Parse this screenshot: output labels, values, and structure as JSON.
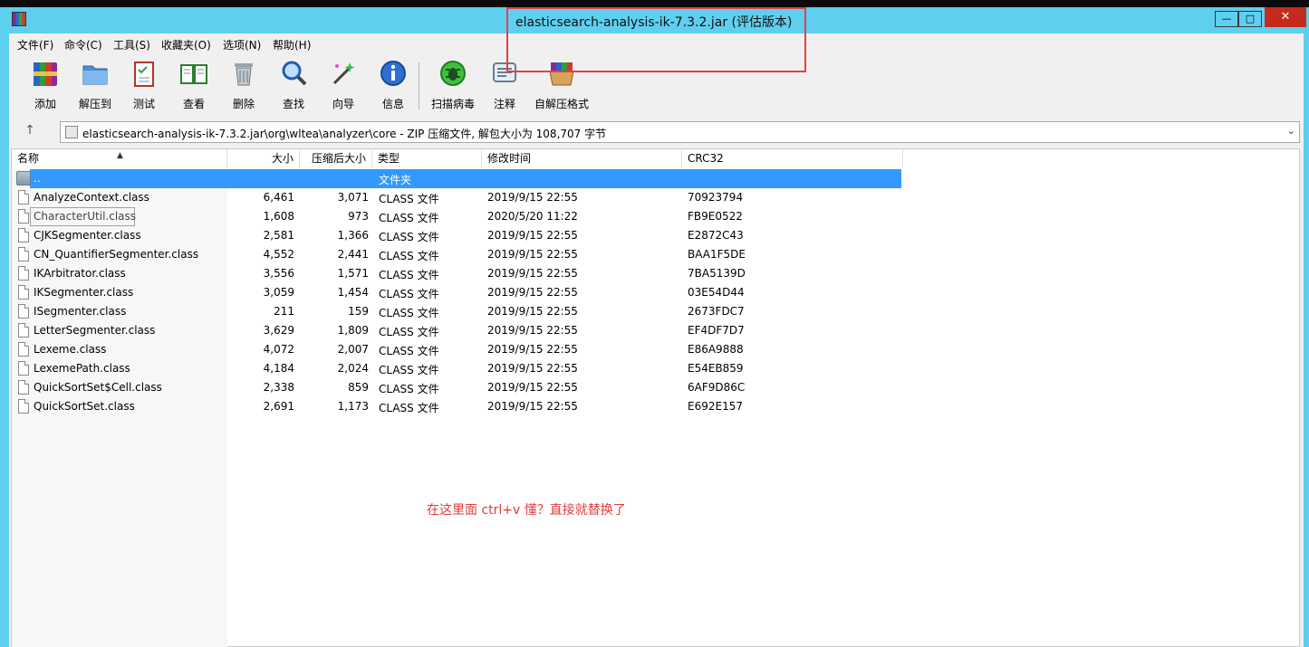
{
  "window": {
    "title": "elasticsearch-analysis-ik-7.3.2.jar (评估版本)",
    "controls": {
      "minimize": "—",
      "maximize": "□",
      "close": "✕"
    }
  },
  "menu": [
    "文件(F)",
    "命令(C)",
    "工具(S)",
    "收藏夹(O)",
    "选项(N)",
    "帮助(H)"
  ],
  "toolbar": [
    {
      "label": "添加",
      "icon": "add-archive-icon"
    },
    {
      "label": "解压到",
      "icon": "extract-to-icon"
    },
    {
      "label": "测试",
      "icon": "test-icon"
    },
    {
      "label": "查看",
      "icon": "view-icon"
    },
    {
      "label": "删除",
      "icon": "delete-icon"
    },
    {
      "label": "查找",
      "icon": "find-icon"
    },
    {
      "label": "向导",
      "icon": "wizard-icon"
    },
    {
      "label": "信息",
      "icon": "info-icon"
    },
    {
      "label": "扫描病毒",
      "icon": "virus-scan-icon"
    },
    {
      "label": "注释",
      "icon": "comment-icon"
    },
    {
      "label": "自解压格式",
      "icon": "sfx-icon"
    }
  ],
  "address": {
    "up": "↑",
    "path": "elasticsearch-analysis-ik-7.3.2.jar\\org\\wltea\\analyzer\\core - ZIP 压缩文件, 解包大小为 108,707 字节",
    "dropdown": "⌄"
  },
  "columns": {
    "name": "名称",
    "size": "大小",
    "packed": "压缩后大小",
    "type": "类型",
    "modified": "修改时间",
    "crc": "CRC32"
  },
  "sort_arrow": "▲",
  "parent_row": {
    "name": "..",
    "type": "文件夹"
  },
  "files": [
    {
      "name": "AnalyzeContext.class",
      "size": "6,461",
      "packed": "3,071",
      "type": "CLASS 文件",
      "modified": "2019/9/15 22:55",
      "crc": "70923794"
    },
    {
      "name": "CharacterUtil.class",
      "size": "1,608",
      "packed": "973",
      "type": "CLASS 文件",
      "modified": "2020/5/20 11:22",
      "crc": "FB9E0522"
    },
    {
      "name": "CJKSegmenter.class",
      "size": "2,581",
      "packed": "1,366",
      "type": "CLASS 文件",
      "modified": "2019/9/15 22:55",
      "crc": "E2872C43"
    },
    {
      "name": "CN_QuantifierSegmenter.class",
      "size": "4,552",
      "packed": "2,441",
      "type": "CLASS 文件",
      "modified": "2019/9/15 22:55",
      "crc": "BAA1F5DE"
    },
    {
      "name": "IKArbitrator.class",
      "size": "3,556",
      "packed": "1,571",
      "type": "CLASS 文件",
      "modified": "2019/9/15 22:55",
      "crc": "7BA5139D"
    },
    {
      "name": "IKSegmenter.class",
      "size": "3,059",
      "packed": "1,454",
      "type": "CLASS 文件",
      "modified": "2019/9/15 22:55",
      "crc": "03E54D44"
    },
    {
      "name": "ISegmenter.class",
      "size": "211",
      "packed": "159",
      "type": "CLASS 文件",
      "modified": "2019/9/15 22:55",
      "crc": "2673FDC7"
    },
    {
      "name": "LetterSegmenter.class",
      "size": "3,629",
      "packed": "1,809",
      "type": "CLASS 文件",
      "modified": "2019/9/15 22:55",
      "crc": "EF4DF7D7"
    },
    {
      "name": "Lexeme.class",
      "size": "4,072",
      "packed": "2,007",
      "type": "CLASS 文件",
      "modified": "2019/9/15 22:55",
      "crc": "E86A9888"
    },
    {
      "name": "LexemePath.class",
      "size": "4,184",
      "packed": "2,024",
      "type": "CLASS 文件",
      "modified": "2019/9/15 22:55",
      "crc": "E54EB859"
    },
    {
      "name": "QuickSortSet$Cell.class",
      "size": "2,338",
      "packed": "859",
      "type": "CLASS 文件",
      "modified": "2019/9/15 22:55",
      "crc": "6AF9D86C"
    },
    {
      "name": "QuickSortSet.class",
      "size": "2,691",
      "packed": "1,173",
      "type": "CLASS 文件",
      "modified": "2019/9/15 22:55",
      "crc": "E692E157"
    }
  ],
  "annotation": "在这里面 ctrl+v 懂？直接就替换了",
  "colors": {
    "titlebar": "#5fcff0",
    "selection": "#3399ff",
    "annotation_red": "#e03b3b",
    "close_button": "#c42b1c"
  }
}
